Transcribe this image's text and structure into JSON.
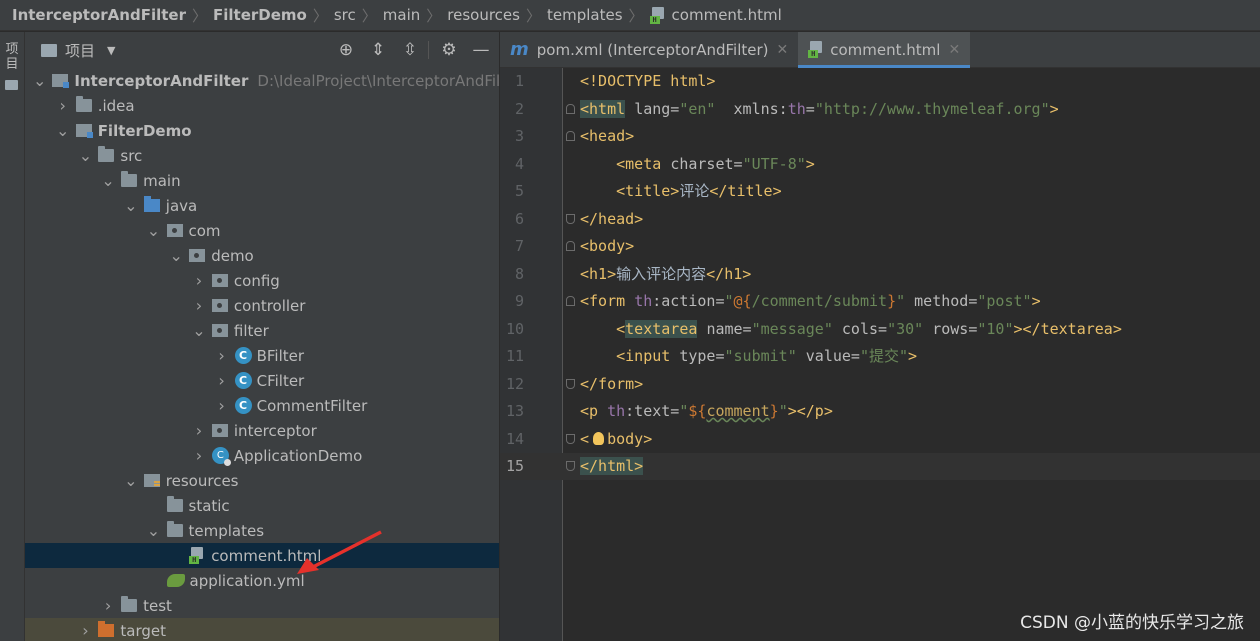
{
  "breadcrumb": [
    {
      "label": "InterceptorAndFilter",
      "bold": true
    },
    {
      "label": "FilterDemo",
      "bold": true
    },
    {
      "label": "src"
    },
    {
      "label": "main"
    },
    {
      "label": "resources"
    },
    {
      "label": "templates"
    },
    {
      "label": "comment.html",
      "file": true
    }
  ],
  "strip": {
    "label": "项目"
  },
  "project_panel": {
    "title": "项目",
    "tree": [
      {
        "label": "InterceptorAndFilter",
        "path": "D:\\IdealProject\\InterceptorAndFilte",
        "depth": 0,
        "icon": "module",
        "expanded": true,
        "bold": true
      },
      {
        "label": ".idea",
        "depth": 1,
        "icon": "folder",
        "expanded": false
      },
      {
        "label": "FilterDemo",
        "depth": 1,
        "icon": "module",
        "expanded": true,
        "bold": true
      },
      {
        "label": "src",
        "depth": 2,
        "icon": "folder",
        "expanded": true
      },
      {
        "label": "main",
        "depth": 3,
        "icon": "folder",
        "expanded": true
      },
      {
        "label": "java",
        "depth": 4,
        "icon": "srcfolder",
        "expanded": true
      },
      {
        "label": "com",
        "depth": 5,
        "icon": "pkg",
        "expanded": true
      },
      {
        "label": "demo",
        "depth": 6,
        "icon": "pkg",
        "expanded": true
      },
      {
        "label": "config",
        "depth": 7,
        "icon": "pkg",
        "expanded": false
      },
      {
        "label": "controller",
        "depth": 7,
        "icon": "pkg",
        "expanded": false
      },
      {
        "label": "filter",
        "depth": 7,
        "icon": "pkg",
        "expanded": true
      },
      {
        "label": "BFilter",
        "depth": 8,
        "icon": "class",
        "expanded": false
      },
      {
        "label": "CFilter",
        "depth": 8,
        "icon": "class",
        "expanded": false
      },
      {
        "label": "CommentFilter",
        "depth": 8,
        "icon": "class",
        "expanded": false
      },
      {
        "label": "interceptor",
        "depth": 7,
        "icon": "pkg",
        "expanded": false
      },
      {
        "label": "ApplicationDemo",
        "depth": 7,
        "icon": "app",
        "expanded": false
      },
      {
        "label": "resources",
        "depth": 4,
        "icon": "res",
        "expanded": true
      },
      {
        "label": "static",
        "depth": 5,
        "icon": "folder",
        "leaf": true
      },
      {
        "label": "templates",
        "depth": 5,
        "icon": "folder",
        "expanded": true
      },
      {
        "label": "comment.html",
        "depth": 6,
        "icon": "html",
        "leaf": true,
        "selected": true
      },
      {
        "label": "application.yml",
        "depth": 5,
        "icon": "yml",
        "leaf": true
      },
      {
        "label": "test",
        "depth": 3,
        "icon": "folder",
        "expanded": false
      },
      {
        "label": "target",
        "depth": 2,
        "icon": "target",
        "expanded": false,
        "excluded": true
      }
    ]
  },
  "tabs": [
    {
      "label": "pom.xml (InterceptorAndFilter)",
      "icon": "m",
      "active": false
    },
    {
      "label": "comment.html",
      "icon": "html",
      "active": true
    }
  ],
  "code": {
    "current_line": 15,
    "lines": [
      {
        "n": "1",
        "html": "<span class=\"t\">&lt;!DOCTYPE html&gt;</span>"
      },
      {
        "n": "2",
        "fold": "up",
        "html": "<span class=\"hl t\">&lt;html</span> <span class=\"a\">lang=</span><span class=\"s\">\"en\"</span>  <span class=\"a\">xmlns:</span><span class=\"ns\">th</span><span class=\"a\">=</span><span class=\"s\">\"http://www.thymeleaf.org\"</span><span class=\"t\">&gt;</span>"
      },
      {
        "n": "3",
        "fold": "up",
        "html": "<span class=\"t\">&lt;head&gt;</span>"
      },
      {
        "n": "4",
        "html": "    <span class=\"t\">&lt;meta</span> <span class=\"a\">charset=</span><span class=\"s\">\"UTF-8\"</span><span class=\"t\">&gt;</span>"
      },
      {
        "n": "5",
        "html": "    <span class=\"t\">&lt;title&gt;</span>评论<span class=\"t\">&lt;/title&gt;</span>"
      },
      {
        "n": "6",
        "fold": "down",
        "html": "<span class=\"t\">&lt;/head&gt;</span>"
      },
      {
        "n": "7",
        "fold": "up",
        "html": "<span class=\"t\">&lt;body&gt;</span>"
      },
      {
        "n": "8",
        "html": "<span class=\"t\">&lt;h1&gt;</span>输入评论内容<span class=\"t\">&lt;/h1&gt;</span>"
      },
      {
        "n": "9",
        "fold": "up",
        "html": "<span class=\"t\">&lt;form</span> <span class=\"ns\">th</span><span class=\"a\">:action=</span><span class=\"s\">\"</span><span class=\"ex\">@{</span><span class=\"s\">/comment/submit</span><span class=\"ex\">}</span><span class=\"s\">\"</span> <span class=\"a\">method=</span><span class=\"s\">\"post\"</span><span class=\"t\">&gt;</span>"
      },
      {
        "n": "10",
        "html": "    <span class=\"t\">&lt;</span><span class=\"t hl\">textarea</span> <span class=\"a\">name=</span><span class=\"s\">\"message\"</span> <span class=\"a\">cols=</span><span class=\"s\">\"30\"</span> <span class=\"a\">rows=</span><span class=\"s\">\"10\"</span><span class=\"t\">&gt;&lt;/textarea&gt;</span>"
      },
      {
        "n": "11",
        "html": "    <span class=\"t\">&lt;input</span> <span class=\"a\">type=</span><span class=\"s\">\"submit\"</span> <span class=\"a\">value=</span><span class=\"s\">\"提交\"</span><span class=\"t\">&gt;</span>"
      },
      {
        "n": "12",
        "fold": "down",
        "html": "<span class=\"t\">&lt;/form&gt;</span>"
      },
      {
        "n": "13",
        "html": "<span class=\"t\">&lt;p</span> <span class=\"ns\">th</span><span class=\"a\">:text=</span><span class=\"s\">\"</span><span class=\"ex\">${</span><span class=\"var\">comment</span><span class=\"ex\">}</span><span class=\"s\">\"</span><span class=\"t\">&gt;&lt;/p&gt;</span>"
      },
      {
        "n": "14",
        "fold": "down",
        "bulb": true,
        "html": "<span class=\"t\">&lt;  body&gt;</span>"
      },
      {
        "n": "15",
        "fold": "down",
        "html": "<span class=\"hl t\">&lt;/html&gt;</span>"
      }
    ]
  },
  "watermark": "CSDN @小蓝的快乐学习之旅"
}
